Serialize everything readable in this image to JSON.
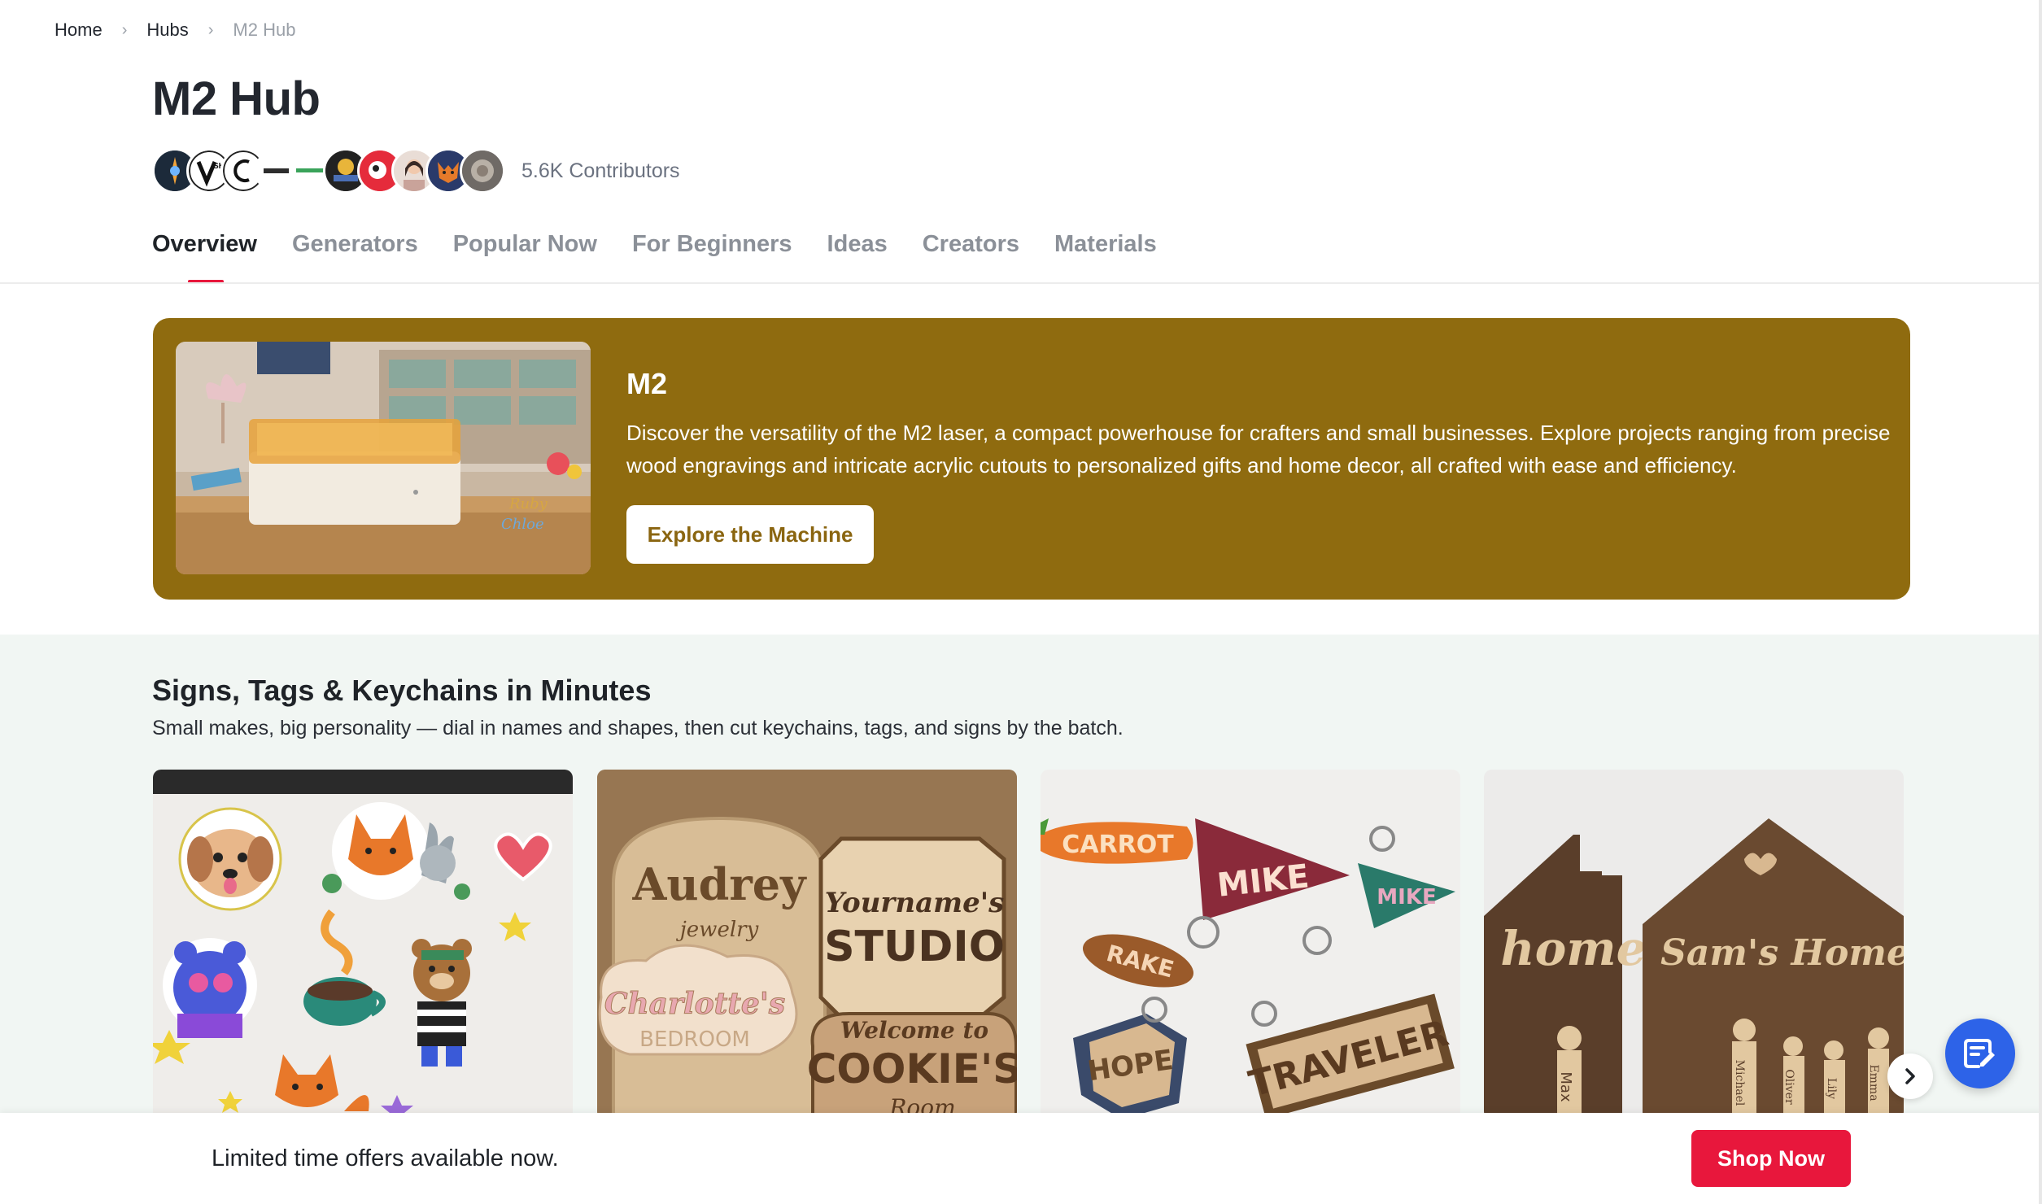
{
  "breadcrumb": {
    "items": [
      "Home",
      "Hubs",
      "M2 Hub"
    ]
  },
  "header": {
    "title": "M2 Hub",
    "contributors": "5.6K Contributors"
  },
  "tabs": [
    "Overview",
    "Generators",
    "Popular Now",
    "For Beginners",
    "Ideas",
    "Creators",
    "Materials"
  ],
  "banner": {
    "title": "M2",
    "description": "Discover the versatility of the M2 laser, a compact powerhouse for crafters and small businesses. Explore projects ranging from precise wood engravings and intricate acrylic cutouts to personalized gifts and home decor, all crafted with ease and efficiency.",
    "button": "Explore the Machine",
    "color": "#8f6b0f"
  },
  "section": {
    "title": "Signs, Tags & Keychains in Minutes",
    "subtitle": "Small makes, big personality — dial in names and shapes, then cut keychains, tags, and signs by the batch."
  },
  "cards": [
    {
      "label": "sticker-set"
    },
    {
      "label": "wood-signs",
      "texts": [
        "Audrey",
        "jewelry",
        "Yourname's",
        "STUDIO",
        "Charlotte's",
        "BEDROOM",
        "Welcome to",
        "COOKIE'S",
        "Room"
      ]
    },
    {
      "label": "keychains",
      "texts": [
        "CARROT",
        "MIKE",
        "MIKE",
        "RAKE",
        "HOPE",
        "TRAVELER"
      ]
    },
    {
      "label": "key-holders",
      "texts": [
        "home",
        "Sam's Home",
        "Max",
        "Michael",
        "Oliver",
        "Lily",
        "Emma"
      ]
    }
  ],
  "offer_bar": {
    "text": "Limited time offers available now.",
    "button": "Shop Now",
    "button_color": "#e8173c"
  },
  "icons": {
    "next": "chevron-right-icon",
    "chat": "feedback-icon",
    "breadcrumb_sep": "chevron-right-icon"
  }
}
